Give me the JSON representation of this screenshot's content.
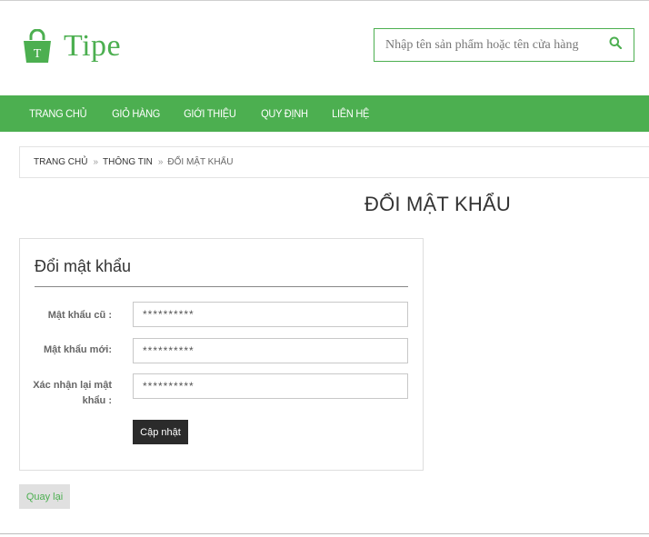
{
  "brand": {
    "name": "Tipe",
    "icon": "shopping-bag-icon",
    "icon_letter": "T",
    "color": "#4caf50"
  },
  "search": {
    "placeholder": "Nhập tên sản phẩm hoặc tên cửa hàng",
    "icon": "search-icon"
  },
  "nav": {
    "items": [
      {
        "label": "TRANG CHỦ"
      },
      {
        "label": "GIỎ HÀNG"
      },
      {
        "label": "GIỚI THIỆU"
      },
      {
        "label": "QUY ĐỊNH"
      },
      {
        "label": "LIÊN HỆ"
      }
    ]
  },
  "breadcrumb": {
    "items": [
      "TRANG CHỦ",
      "THÔNG TIN"
    ],
    "separator": "»",
    "current": "ĐỔI MẬT KHẨU"
  },
  "page": {
    "title": "ĐỔI MẬT KHẨU"
  },
  "form": {
    "title": "Đổi mật khẩu",
    "fields": [
      {
        "label": "Mật khẩu cũ :",
        "value": "**********"
      },
      {
        "label": "Mật khẩu mới:",
        "value": "**********"
      },
      {
        "label_line1": "Xác nhận lại mật",
        "label_line2": "khẩu :",
        "value": "**********"
      }
    ],
    "submit_label": "Cập nhật"
  },
  "back_label": "Quay lại"
}
